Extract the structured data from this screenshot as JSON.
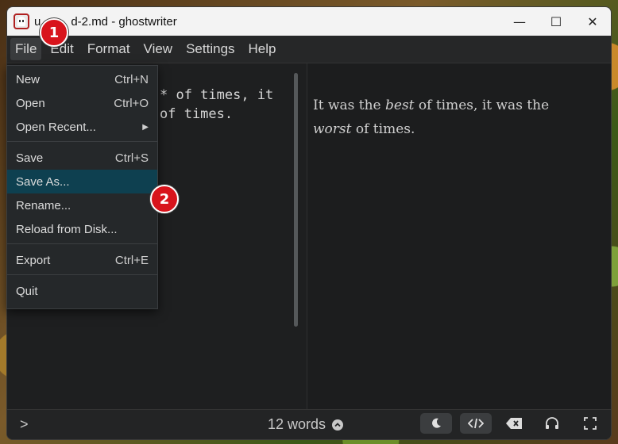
{
  "window": {
    "title": "untitled-2.md - ghostwriter",
    "title_visible": "u",
    "title_visible_rest": "d-2.md - ghostwriter"
  },
  "window_controls": {
    "minimize": "—",
    "maximize": "☐",
    "close": "✕"
  },
  "menubar": {
    "items": [
      {
        "label": "File"
      },
      {
        "label": "Edit"
      },
      {
        "label": "Format"
      },
      {
        "label": "View"
      },
      {
        "label": "Settings"
      },
      {
        "label": "Help"
      }
    ]
  },
  "editor": {
    "line1": "* of times, it",
    "line2": "of times."
  },
  "preview": {
    "p1": "It was the ",
    "em1": "best",
    "p2": " of times, it was the ",
    "em2": "worst",
    "p3": " of times."
  },
  "file_menu": {
    "items": [
      {
        "label": "New",
        "shortcut": "Ctrl+N"
      },
      {
        "label": "Open",
        "shortcut": "Ctrl+O"
      },
      {
        "label": "Open Recent...",
        "shortcut": ""
      },
      {
        "label": "Save",
        "shortcut": "Ctrl+S"
      },
      {
        "label": "Save As...",
        "shortcut": ""
      },
      {
        "label": "Rename...",
        "shortcut": ""
      },
      {
        "label": "Reload from Disk...",
        "shortcut": ""
      },
      {
        "label": "Export",
        "shortcut": "Ctrl+E"
      },
      {
        "label": "Quit",
        "shortcut": ""
      }
    ],
    "highlighted": "Save As..."
  },
  "statusbar": {
    "expand": ">",
    "word_count": "12 words"
  },
  "annotations": {
    "badge1": "1",
    "badge2": "2"
  },
  "colors": {
    "accent_highlight": "#0e4050",
    "badge": "#d8141c"
  }
}
